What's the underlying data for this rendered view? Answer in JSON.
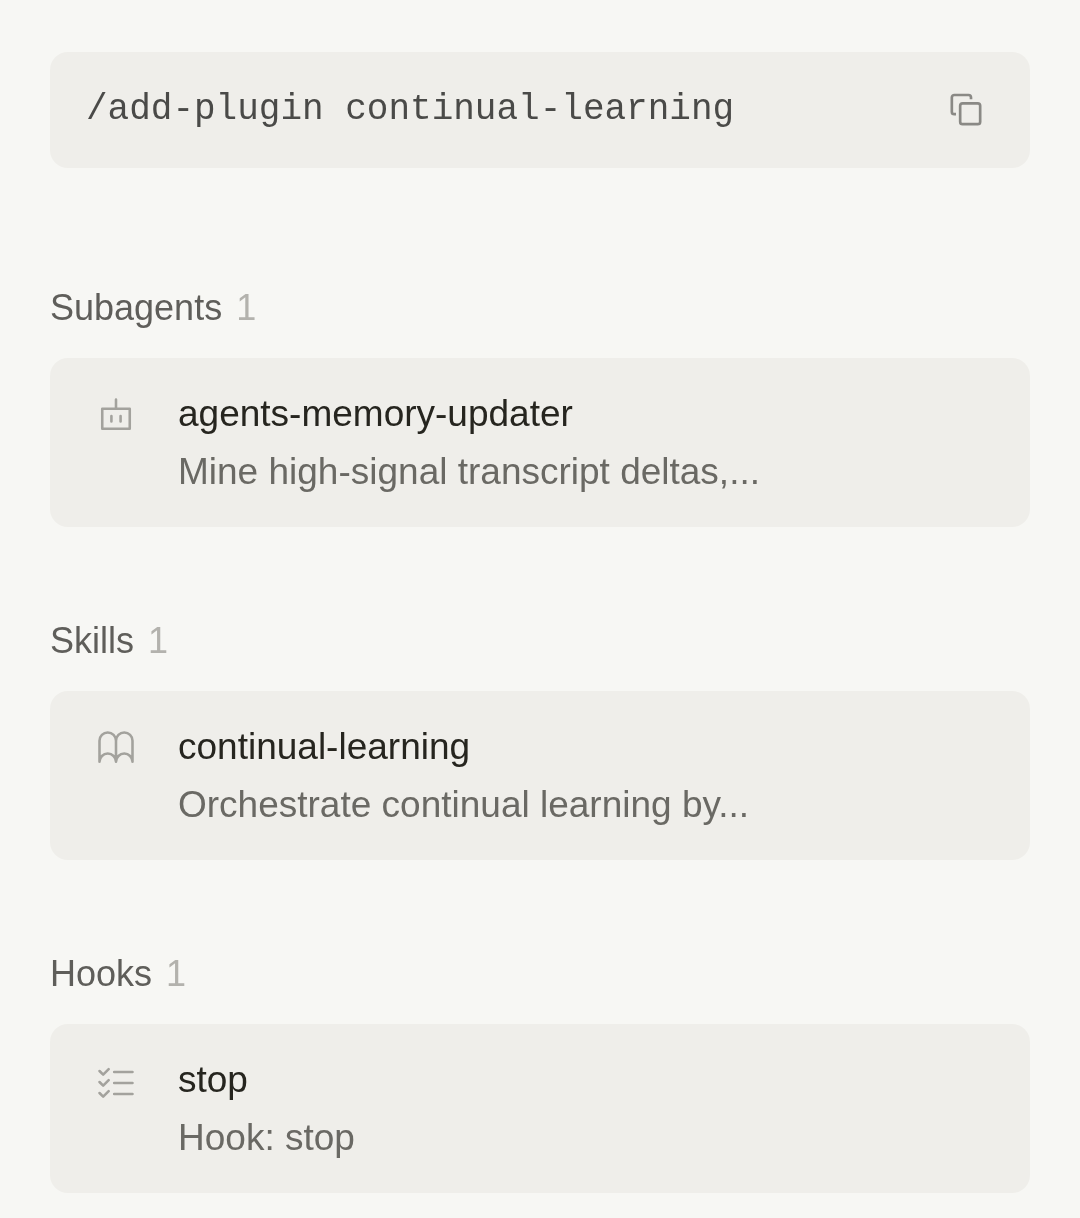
{
  "command": {
    "text": "/add-plugin continual-learning"
  },
  "sections": [
    {
      "title": "Subagents",
      "count": "1",
      "items": [
        {
          "kind": "agent",
          "name": "agents-memory-updater",
          "description": "Mine high-signal transcript deltas,..."
        }
      ]
    },
    {
      "title": "Skills",
      "count": "1",
      "items": [
        {
          "kind": "skill",
          "name": "continual-learning",
          "description": "Orchestrate continual learning by..."
        }
      ]
    },
    {
      "title": "Hooks",
      "count": "1",
      "items": [
        {
          "kind": "hook",
          "name": "stop",
          "description": "Hook: stop"
        }
      ]
    }
  ]
}
